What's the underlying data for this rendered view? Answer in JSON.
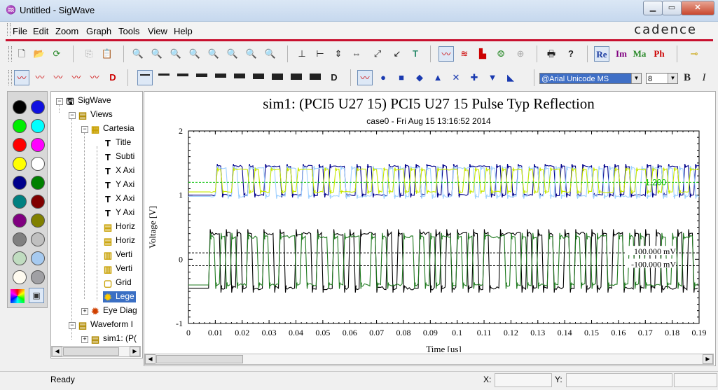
{
  "window": {
    "title": "Untitled - SigWave",
    "app_icon": "sigwave-icon"
  },
  "menu": [
    "File",
    "Edit",
    "Zoom",
    "Graph",
    "Tools",
    "View",
    "Help"
  ],
  "brand": "cadence",
  "format_toolbar": {
    "re": "Re",
    "im": "Im",
    "ma": "Ma",
    "ph": "Ph",
    "bold": "B",
    "italic": "I"
  },
  "font": {
    "name": "@Arial Unicode MS",
    "size": "8"
  },
  "palette_colors": [
    "#000000",
    "#1010e0",
    "#00ee00",
    "#00ffff",
    "#ff0000",
    "#ff00ff",
    "#ffff00",
    "#ffffff",
    "#00008b",
    "#008000",
    "#008080",
    "#800000",
    "#800080",
    "#808000",
    "#808080",
    "#c0c0c0",
    "#c0dcc0",
    "#a6caf0",
    "#fffbf0",
    "#a0a0a4"
  ],
  "tree": {
    "root": "SigWave",
    "views": "Views",
    "cartesian": "Cartesia",
    "items": [
      "Title",
      "Subti",
      "X Axi",
      "Y Axi",
      "X Axi",
      "Y Axi",
      "Horiz",
      "Horiz",
      "Verti",
      "Verti",
      "Grid",
      "Lege"
    ],
    "eye": "Eye Diag",
    "waveform": "Waveform I",
    "sim": "sim1: (P("
  },
  "chart_data": {
    "type": "line",
    "title": "sim1: (PCI5 U27 15) PCI5 U27 15 Pulse Typ Reflection",
    "subtitle": "case0 - Fri Aug 15 13:16:52 2014",
    "xlabel": "Time [us]",
    "ylabel": "Voltage [V]",
    "xlim": [
      0,
      0.19
    ],
    "ylim": [
      -1,
      2
    ],
    "xticks": [
      "0",
      "0.01",
      "0.02",
      "0.03",
      "0.04",
      "0.05",
      "0.06",
      "0.07",
      "0.08",
      "0.09",
      "0.1",
      "0.11",
      "0.12",
      "0.13",
      "0.14",
      "0.15",
      "0.16",
      "0.17",
      "0.18",
      "0.19"
    ],
    "yticks": [
      "-1",
      "0",
      "1",
      "2"
    ],
    "grid": false,
    "bit_period_us": 0.002,
    "series": [
      {
        "color": "#000000",
        "high": 0.4,
        "low": -0.45,
        "start": 0.0075
      },
      {
        "color": "#1f7a1f",
        "high": 0.35,
        "low": -0.4,
        "start": 0.0075
      },
      {
        "color": "#00008b",
        "high": 1.45,
        "low": 1.0,
        "start": 0.008
      },
      {
        "color": "#9fd0ff",
        "high": 1.42,
        "low": 0.98,
        "start": 0.008
      },
      {
        "color": "#c8e800",
        "high": 1.4,
        "low": 1.05,
        "start": 0.008
      }
    ],
    "thresholds": [
      {
        "label": "100.000 mV",
        "value": 0.1,
        "color": "#000000"
      },
      {
        "label": "-100.000 mV",
        "value": -0.1,
        "color": "#000000"
      },
      {
        "label": "1.200",
        "value": 1.2,
        "color": "#00c000"
      }
    ]
  },
  "status": {
    "text": "Ready",
    "x_label": "X:",
    "y_label": "Y:"
  }
}
